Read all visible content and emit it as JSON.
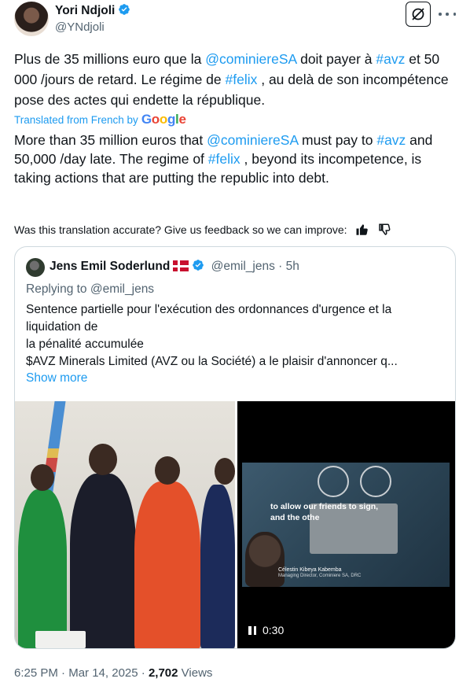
{
  "author": {
    "name": "Yori Ndjoli",
    "handle": "@YNdjoli"
  },
  "post": {
    "fr_parts": [
      "Plus de 35 millions euro que la ",
      "@cominiereSA",
      " doit payer à ",
      "#avz",
      " et 50 000 /jours de retard. Le régime de ",
      "#felix",
      " , au delà de son incompétence pose des actes qui endette la république."
    ],
    "translated_label": "Translated from French by",
    "translator": "Google",
    "en_parts": [
      "More than 35 million euros that ",
      "@cominiereSA",
      " must pay to ",
      "#avz",
      " and 50,000 /day late. The regime of ",
      "#felix",
      " , beyond its incompetence, is taking actions that are putting the republic into debt."
    ],
    "feedback": "Was this translation accurate? Give us feedback so we can improve:"
  },
  "quote": {
    "name": "Jens Emil Soderlund",
    "handle": "@emil_jens",
    "time": "5h",
    "replying": "Replying to @emil_jens",
    "lines": [
      "Sentence partielle pour l'exécution des ordonnances d'urgence et la",
      "liquidation de",
      "la pénalité accumulée",
      "$AVZ Minerals Limited (AVZ ou la Société) a le plaisir d'annoncer q..."
    ],
    "show_more": "Show more",
    "video": {
      "caption_line1": "to allow our friends to sign,",
      "caption_line2": "and the othe",
      "person_name": "Célestin Kibeya Kabemba",
      "person_title": "Managing Director, Cominiere SA, DRC",
      "duration": "0:30"
    }
  },
  "meta": {
    "time": "6:25 PM",
    "sep1": "·",
    "date": "Mar 14, 2025",
    "sep2": "·",
    "views": "2,702",
    "views_label": "Views"
  },
  "colors": {
    "accent": "#1d9bf0",
    "secondary_text": "#536471",
    "border": "#cfd9de"
  }
}
